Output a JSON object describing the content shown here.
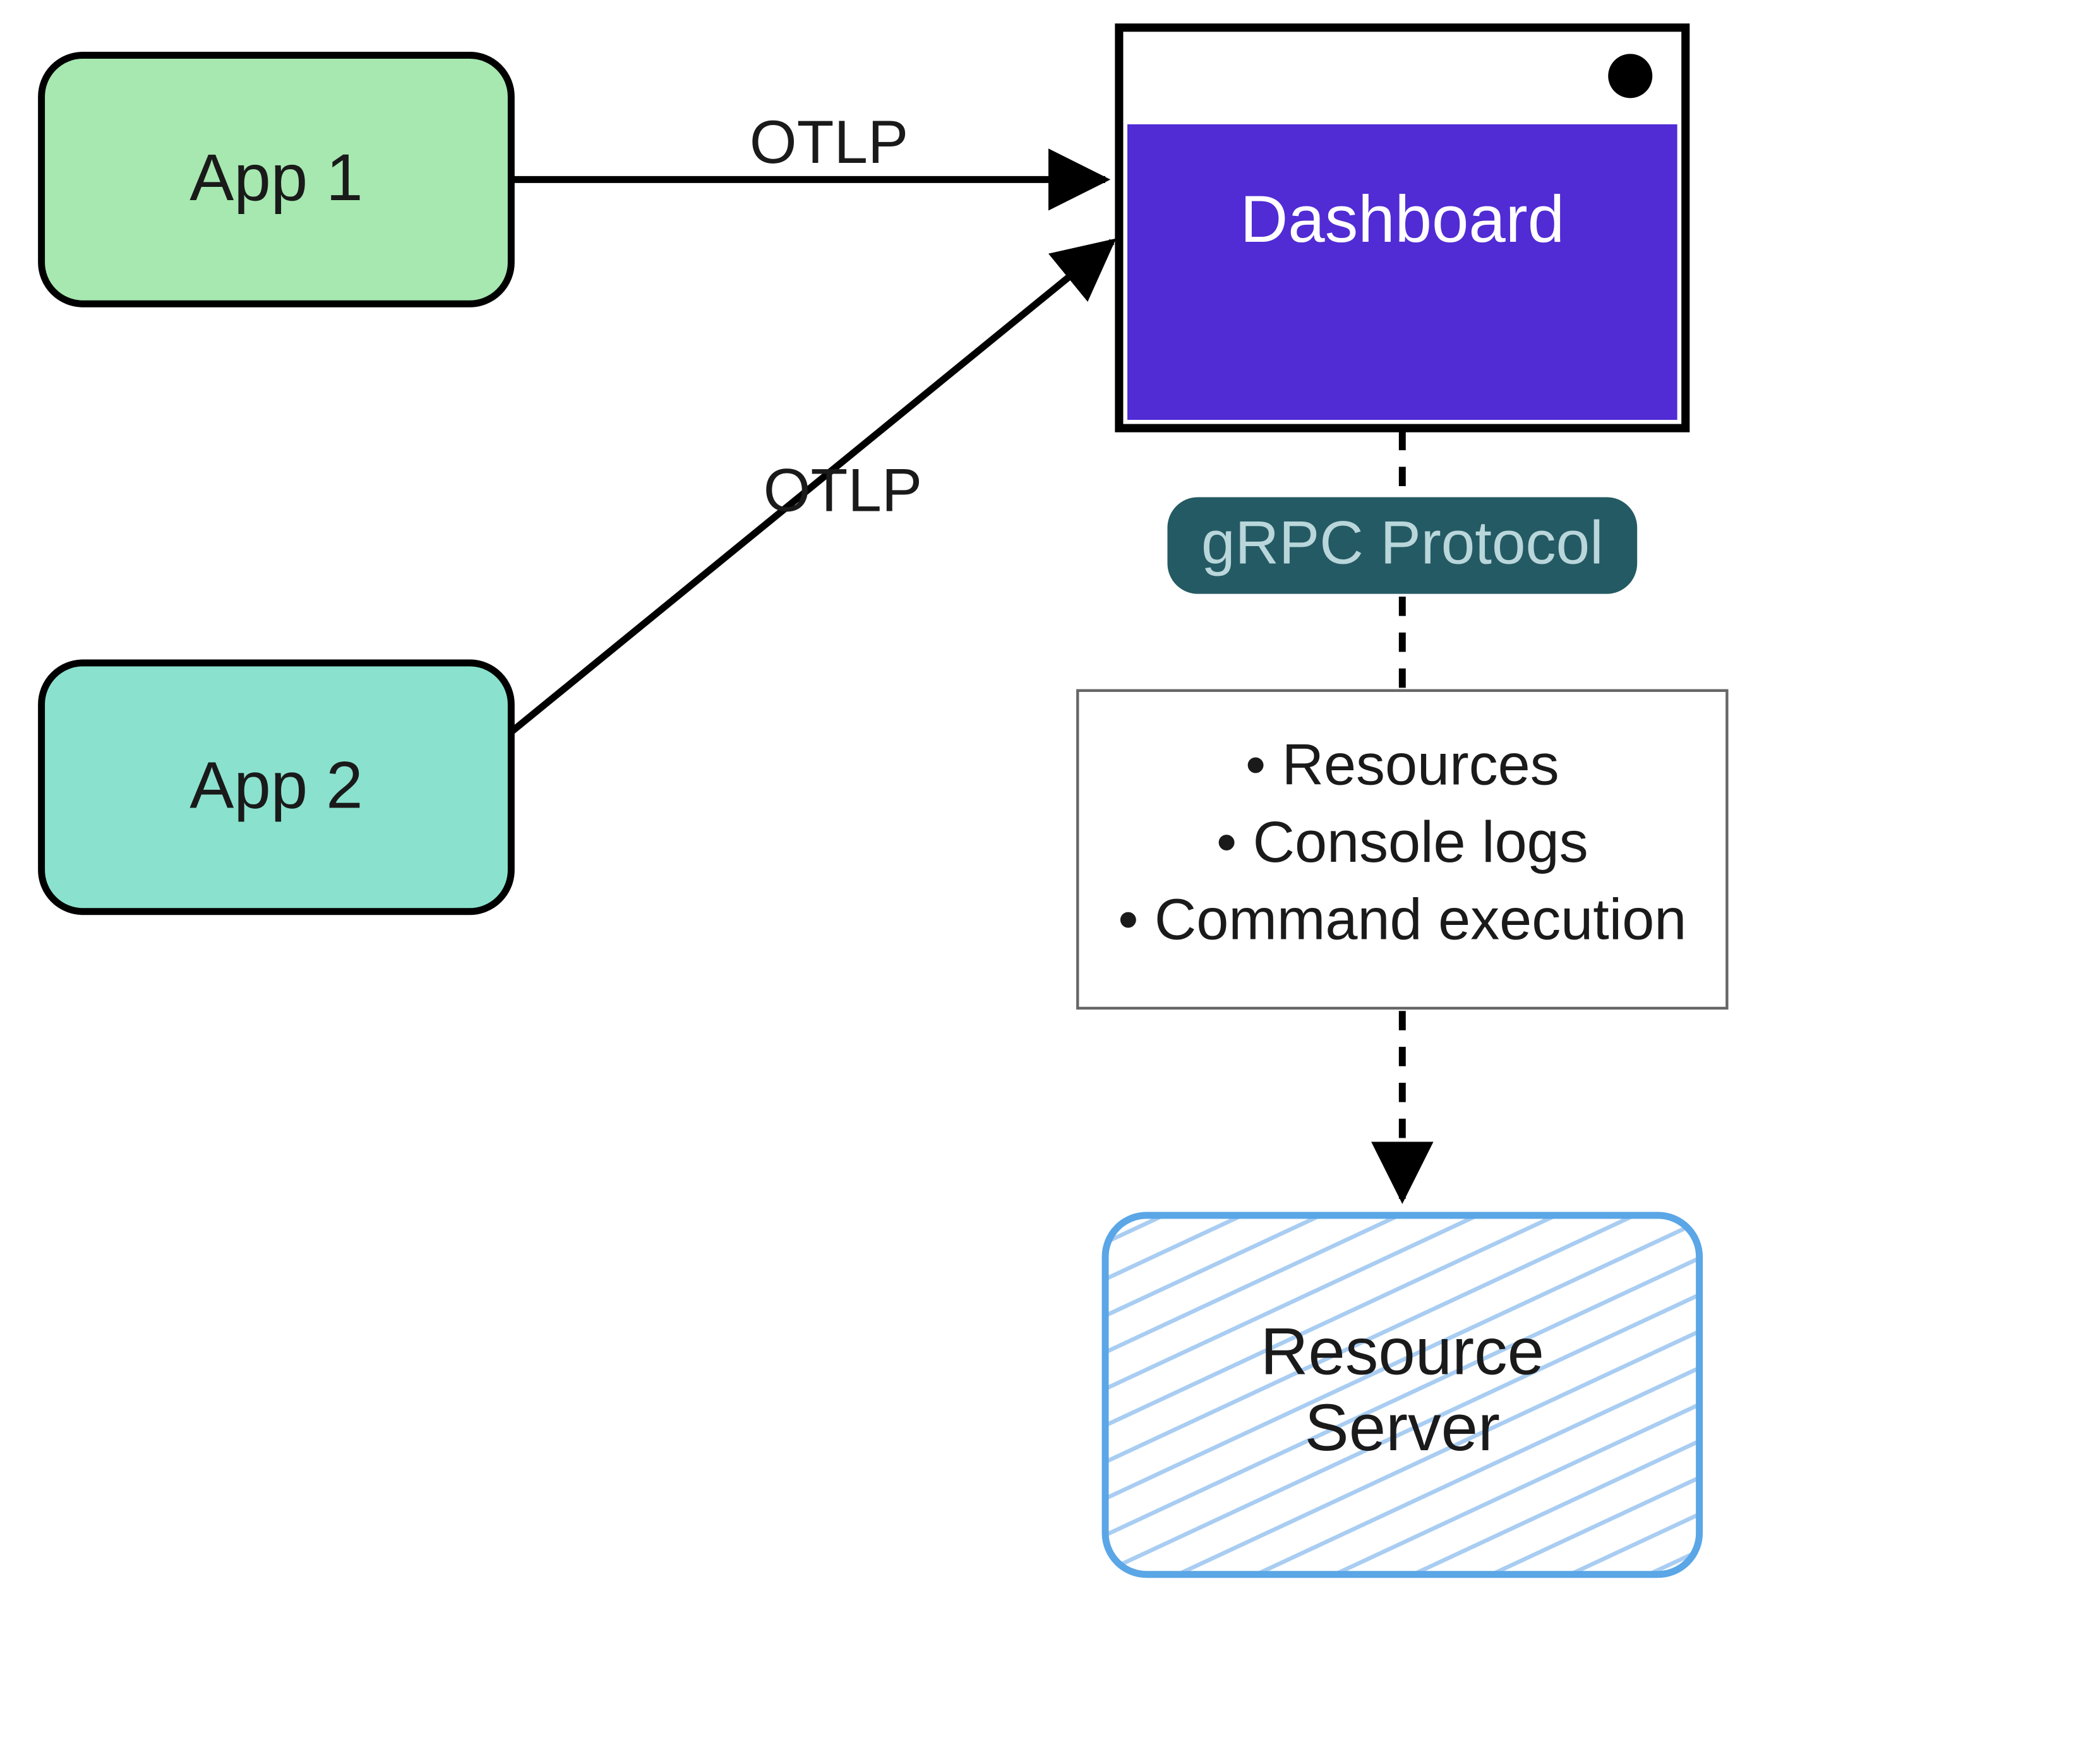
{
  "nodes": {
    "app1": {
      "label": "App 1"
    },
    "app2": {
      "label": "App 2"
    },
    "dashboard": {
      "label": "Dashboard"
    },
    "resource_server": {
      "line1": "Resource",
      "line2": "Server"
    }
  },
  "edges": {
    "otlp1": {
      "label": "OTLP"
    },
    "otlp2": {
      "label": "OTLP"
    },
    "grpc": {
      "label": "gRPC Protocol"
    }
  },
  "features": {
    "item1": "• Resources",
    "item2": "• Console logs",
    "item3": "• Command execution"
  },
  "colors": {
    "app1_fill": "#a6e8b0",
    "app2_fill": "#8ae2ce",
    "dashboard_fill": "#512bd4",
    "grpc_fill": "#245a63",
    "resource_stroke": "#5aa6e6",
    "stroke": "#000000"
  }
}
